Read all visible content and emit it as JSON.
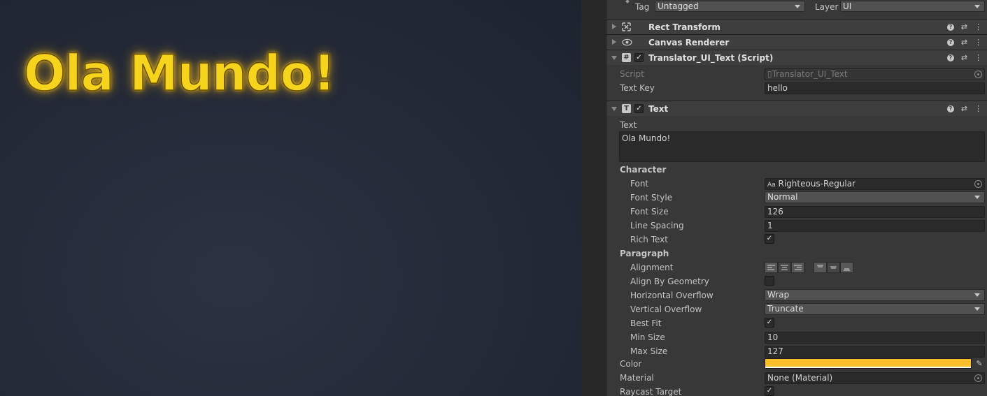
{
  "game_view": {
    "display_text": "Ola Mundo!",
    "text_color": "#f6d31c"
  },
  "header": {
    "tag_label": "Tag",
    "tag_value": "Untagged",
    "layer_label": "Layer",
    "layer_value": "UI"
  },
  "components": {
    "rect_transform": {
      "title": "Rect Transform",
      "icon": "rect-transform-icon"
    },
    "canvas_renderer": {
      "title": "Canvas Renderer",
      "icon": "eye-icon"
    },
    "translator": {
      "title": "Translator_UI_Text (Script)",
      "enabled_mark": "✓",
      "script_label": "Script",
      "script_value": "Translator_UI_Text",
      "text_key_label": "Text Key",
      "text_key_value": "hello"
    },
    "text": {
      "title": "Text",
      "enabled_mark": "✓",
      "text_label": "Text",
      "text_value": "Ola Mundo!",
      "character_section": "Character",
      "font_label": "Font",
      "font_prefix": "Aa",
      "font_value": "Righteous-Regular",
      "font_style_label": "Font Style",
      "font_style_value": "Normal",
      "font_size_label": "Font Size",
      "font_size_value": "126",
      "line_spacing_label": "Line Spacing",
      "line_spacing_value": "1",
      "rich_text_label": "Rich Text",
      "rich_text_mark": "✓",
      "paragraph_section": "Paragraph",
      "alignment_label": "Alignment",
      "align_by_geometry_label": "Align By Geometry",
      "horizontal_overflow_label": "Horizontal Overflow",
      "horizontal_overflow_value": "Wrap",
      "vertical_overflow_label": "Vertical Overflow",
      "vertical_overflow_value": "Truncate",
      "best_fit_label": "Best Fit",
      "best_fit_mark": "✓",
      "min_size_label": "Min Size",
      "min_size_value": "10",
      "max_size_label": "Max Size",
      "max_size_value": "127",
      "color_label": "Color",
      "color_value": "#fbbf2b",
      "material_label": "Material",
      "material_value": "None (Material)",
      "raycast_target_label": "Raycast Target",
      "raycast_target_mark": "✓"
    }
  },
  "icons": {
    "help": "?",
    "presets": "⇄",
    "more": "⋮",
    "picker": "✎",
    "script_file": "▯",
    "text_component": "T",
    "script_component": "#"
  }
}
